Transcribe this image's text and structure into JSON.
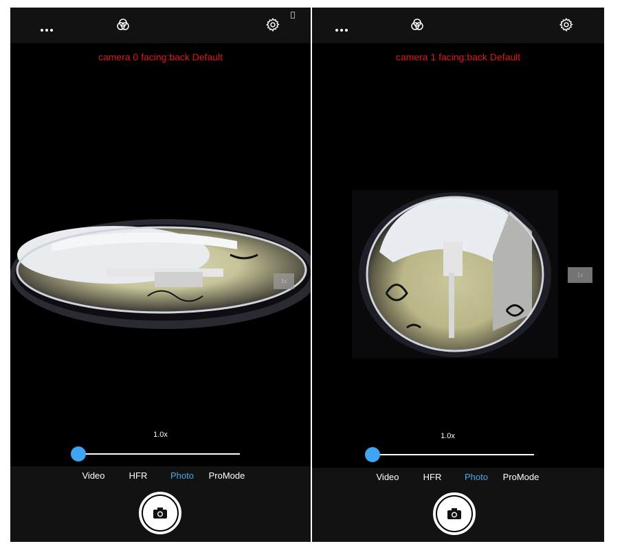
{
  "screens": [
    {
      "camera_label": "camera 0 facing:back Default",
      "zoom_value": "1.0x",
      "zoom_pill": "1x",
      "modes": [
        "Video",
        "HFR",
        "Photo",
        "ProMode"
      ],
      "active_mode": "Photo",
      "zoom_level": 0.0
    },
    {
      "camera_label": "camera 1 facing:back Default",
      "zoom_value": "1.0x",
      "zoom_pill": "1x",
      "modes": [
        "Video",
        "HFR",
        "Photo",
        "ProMode"
      ],
      "active_mode": "Photo",
      "zoom_level": 0.0
    }
  ],
  "icons": [
    "more-icon",
    "filter-icon",
    "settings-icon",
    "camera-icon",
    "battery-icon"
  ],
  "colors": {
    "label_red": "#e3151b",
    "accent_blue": "#3da5f4",
    "active_mode_blue": "#4aa8ea",
    "bar_bg": "#121212"
  }
}
